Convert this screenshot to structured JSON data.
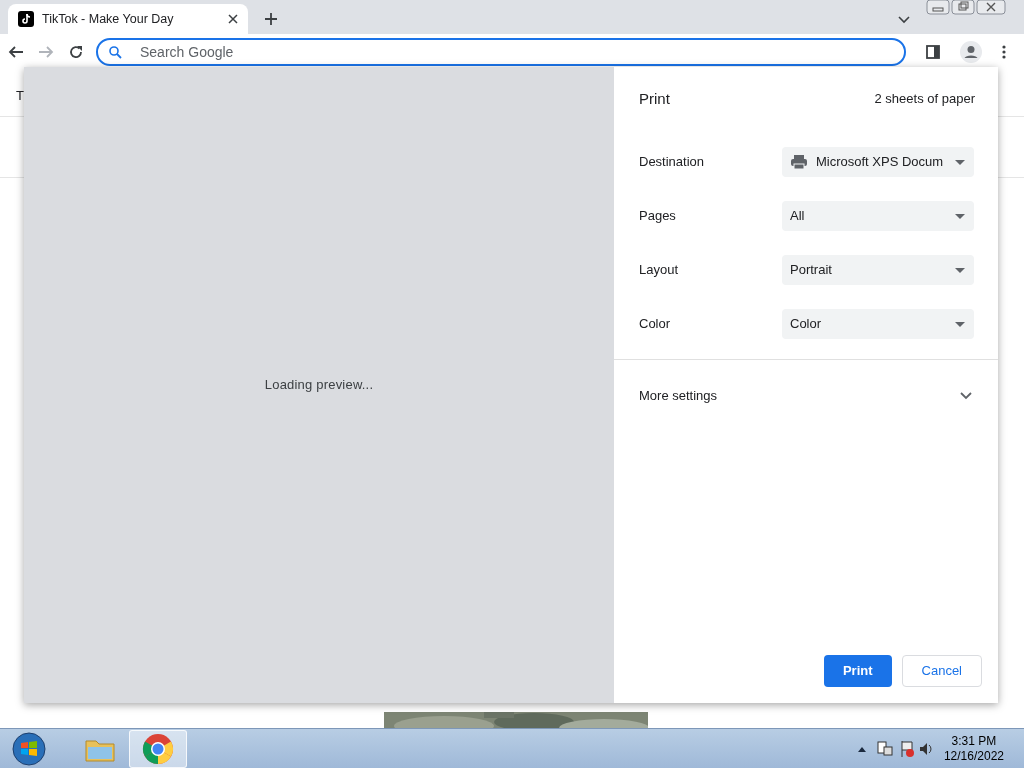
{
  "browser": {
    "tab": {
      "title": "TikTok - Make Your Day"
    },
    "address_bar": {
      "placeholder": "Search Google",
      "focused": true
    }
  },
  "page": {
    "nav_fragment": "T"
  },
  "print_dialog": {
    "title": "Print",
    "sheets": "2 sheets of paper",
    "preview_status": "Loading preview...",
    "settings": [
      {
        "label": "Destination",
        "value": "Microsoft XPS Docum",
        "kind": "printer"
      },
      {
        "label": "Pages",
        "value": "All",
        "kind": "plain"
      },
      {
        "label": "Layout",
        "value": "Portrait",
        "kind": "plain"
      },
      {
        "label": "Color",
        "value": "Color",
        "kind": "plain"
      }
    ],
    "more_settings": {
      "label": "More settings",
      "expanded": false
    },
    "buttons": [
      {
        "label": "Print",
        "kind": "primary"
      },
      {
        "label": "Cancel",
        "kind": "secondary"
      }
    ]
  },
  "taskbar": {
    "apps": [
      {
        "kind": "folder",
        "selected": false
      },
      {
        "kind": "chrome",
        "selected": true
      }
    ],
    "time": "3:31 PM",
    "date": "12/16/2022"
  }
}
